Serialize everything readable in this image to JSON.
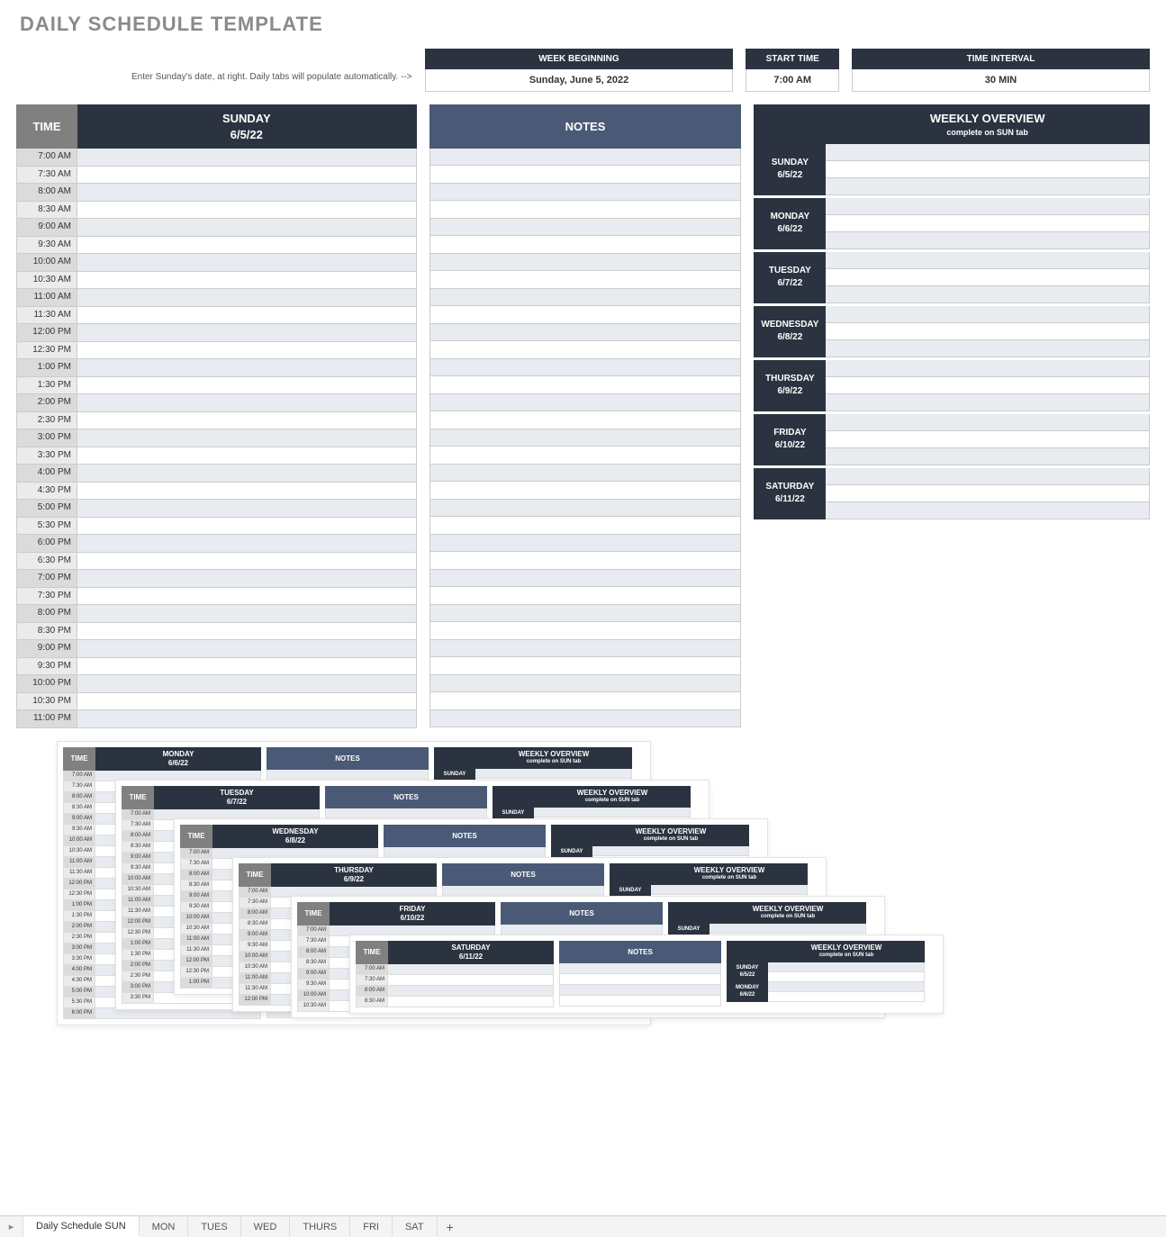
{
  "title": "DAILY SCHEDULE TEMPLATE",
  "instruction": "Enter Sunday's date, at right.  Daily tabs will populate automatically.  -->",
  "top": {
    "week_beginning_label": "WEEK BEGINNING",
    "week_beginning_value": "Sunday, June 5, 2022",
    "start_time_label": "START TIME",
    "start_time_value": "7:00 AM",
    "time_interval_label": "TIME INTERVAL",
    "time_interval_value": "30 MIN"
  },
  "headers": {
    "time": "TIME",
    "notes": "NOTES",
    "weekly_overview": "WEEKLY OVERVIEW",
    "weekly_sub": "complete on SUN tab"
  },
  "active_day": {
    "name": "SUNDAY",
    "date": "6/5/22"
  },
  "time_slots": [
    "7:00 AM",
    "7:30 AM",
    "8:00 AM",
    "8:30 AM",
    "9:00 AM",
    "9:30 AM",
    "10:00 AM",
    "10:30 AM",
    "11:00 AM",
    "11:30 AM",
    "12:00 PM",
    "12:30 PM",
    "1:00 PM",
    "1:30 PM",
    "2:00 PM",
    "2:30 PM",
    "3:00 PM",
    "3:30 PM",
    "4:00 PM",
    "4:30 PM",
    "5:00 PM",
    "5:30 PM",
    "6:00 PM",
    "6:30 PM",
    "7:00 PM",
    "7:30 PM",
    "8:00 PM",
    "8:30 PM",
    "9:00 PM",
    "9:30 PM",
    "10:00 PM",
    "10:30 PM",
    "11:00 PM"
  ],
  "week_days": [
    {
      "name": "SUNDAY",
      "date": "6/5/22"
    },
    {
      "name": "MONDAY",
      "date": "6/6/22"
    },
    {
      "name": "TUESDAY",
      "date": "6/7/22"
    },
    {
      "name": "WEDNESDAY",
      "date": "6/8/22"
    },
    {
      "name": "THURSDAY",
      "date": "6/9/22"
    },
    {
      "name": "FRIDAY",
      "date": "6/10/22"
    },
    {
      "name": "SATURDAY",
      "date": "6/11/22"
    }
  ],
  "cascade": [
    {
      "name": "MONDAY",
      "date": "6/6/22",
      "slots": [
        "7:00 AM",
        "7:30 AM",
        "8:00 AM",
        "8:30 AM",
        "9:00 AM",
        "9:30 AM",
        "10:00 AM",
        "10:30 AM",
        "11:00 AM",
        "11:30 AM",
        "12:00 PM",
        "12:30 PM",
        "1:00 PM",
        "1:30 PM",
        "2:00 PM",
        "2:30 PM",
        "3:00 PM",
        "3:30 PM",
        "4:00 PM",
        "4:30 PM",
        "5:00 PM",
        "5:30 PM",
        "6:00 PM"
      ],
      "wk": [
        {
          "name": "SUNDAY",
          "date": ""
        }
      ]
    },
    {
      "name": "TUESDAY",
      "date": "6/7/22",
      "slots": [
        "7:00 AM",
        "7:30 AM",
        "8:00 AM",
        "8:30 AM",
        "9:00 AM",
        "9:30 AM",
        "10:00 AM",
        "10:30 AM",
        "11:00 AM",
        "11:30 AM",
        "12:00 PM",
        "12:30 PM",
        "1:00 PM",
        "1:30 PM",
        "2:00 PM",
        "2:30 PM",
        "3:00 PM",
        "3:30 PM"
      ],
      "wk": [
        {
          "name": "SUNDAY",
          "date": ""
        }
      ]
    },
    {
      "name": "WEDNESDAY",
      "date": "6/8/22",
      "slots": [
        "7:00 AM",
        "7:30 AM",
        "8:00 AM",
        "8:30 AM",
        "9:00 AM",
        "9:30 AM",
        "10:00 AM",
        "10:30 AM",
        "11:00 AM",
        "11:30 AM",
        "12:00 PM",
        "12:30 PM",
        "1:00 PM"
      ],
      "wk": [
        {
          "name": "SUNDAY",
          "date": ""
        }
      ]
    },
    {
      "name": "THURSDAY",
      "date": "6/9/22",
      "slots": [
        "7:00 AM",
        "7:30 AM",
        "8:00 AM",
        "8:30 AM",
        "9:00 AM",
        "9:30 AM",
        "10:00 AM",
        "10:30 AM",
        "11:00 AM",
        "11:30 AM",
        "12:00 PM"
      ],
      "wk": [
        {
          "name": "SUNDAY",
          "date": ""
        }
      ]
    },
    {
      "name": "FRIDAY",
      "date": "6/10/22",
      "slots": [
        "7:00 AM",
        "7:30 AM",
        "8:00 AM",
        "8:30 AM",
        "9:00 AM",
        "9:30 AM",
        "10:00 AM",
        "10:30 AM"
      ],
      "wk": [
        {
          "name": "SUNDAY",
          "date": ""
        }
      ]
    },
    {
      "name": "SATURDAY",
      "date": "6/11/22",
      "slots": [
        "7:00 AM",
        "7:30 AM",
        "8:00 AM",
        "8:30 AM"
      ],
      "wk": [
        {
          "name": "SUNDAY",
          "date": "6/5/22"
        },
        {
          "name": "MONDAY",
          "date": "6/6/22"
        }
      ]
    }
  ],
  "tabs": [
    "Daily Schedule SUN",
    "MON",
    "TUES",
    "WED",
    "THURS",
    "FRI",
    "SAT"
  ],
  "active_tab_index": 0
}
